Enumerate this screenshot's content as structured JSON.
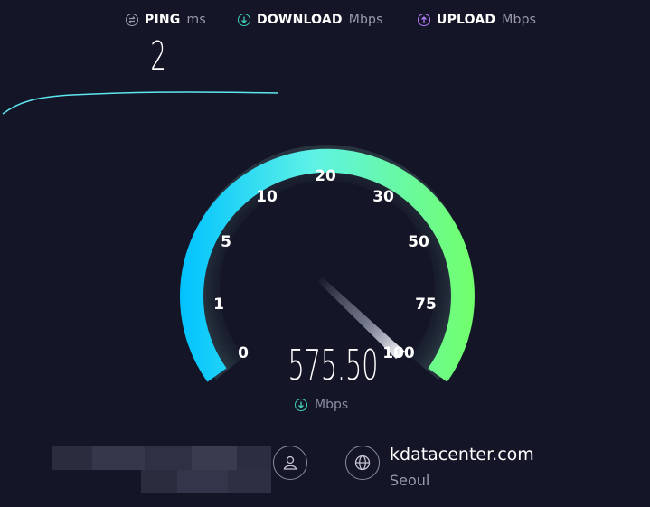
{
  "header": {
    "ping": {
      "name": "PING",
      "unit": "ms",
      "icon": "ping-icon"
    },
    "download": {
      "name": "DOWNLOAD",
      "unit": "Mbps",
      "icon": "download-arrow-icon"
    },
    "upload": {
      "name": "UPLOAD",
      "unit": "Mbps",
      "icon": "upload-arrow-icon"
    }
  },
  "ping_value": "2",
  "gauge": {
    "scale_labels": [
      "0",
      "1",
      "5",
      "10",
      "20",
      "30",
      "50",
      "75",
      "100"
    ],
    "reading": "575.50",
    "reading_unit": "Mbps",
    "colors": {
      "start": "#00c6ff",
      "mid": "#5ef2e6",
      "end": "#72ff6a"
    }
  },
  "connection": {
    "user_icon": "user-icon",
    "server_icon": "globe-icon",
    "server_name": "kdatacenter.com",
    "server_location": "Seoul"
  }
}
